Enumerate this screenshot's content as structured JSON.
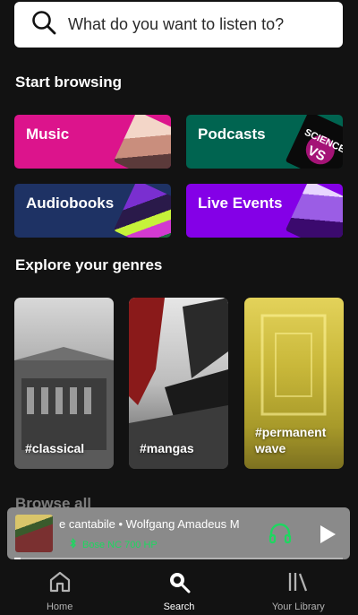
{
  "search": {
    "placeholder": "What do you want to listen to?"
  },
  "sections": {
    "start_browsing": "Start browsing",
    "explore_genres": "Explore your genres",
    "browse_all": "Browse all"
  },
  "browse_cards": [
    {
      "label": "Music",
      "color": "#dc148c"
    },
    {
      "label": "Podcasts",
      "color": "#006450"
    },
    {
      "label": "Audiobooks",
      "color": "#1e3264"
    },
    {
      "label": "Live Events",
      "color": "#8400e7"
    }
  ],
  "genres": [
    {
      "label": "#classical"
    },
    {
      "label": "#mangas"
    },
    {
      "label": "#permanent wave"
    }
  ],
  "player": {
    "title": "e cantabile • Wolfgang Amadeus M",
    "device": "Bose NC 700 HP",
    "progress": 0.02,
    "accent": "#1ed760"
  },
  "nav": [
    {
      "label": "Home",
      "icon": "home-icon",
      "active": false
    },
    {
      "label": "Search",
      "icon": "search-icon",
      "active": true
    },
    {
      "label": "Your Library",
      "icon": "library-icon",
      "active": false
    }
  ]
}
